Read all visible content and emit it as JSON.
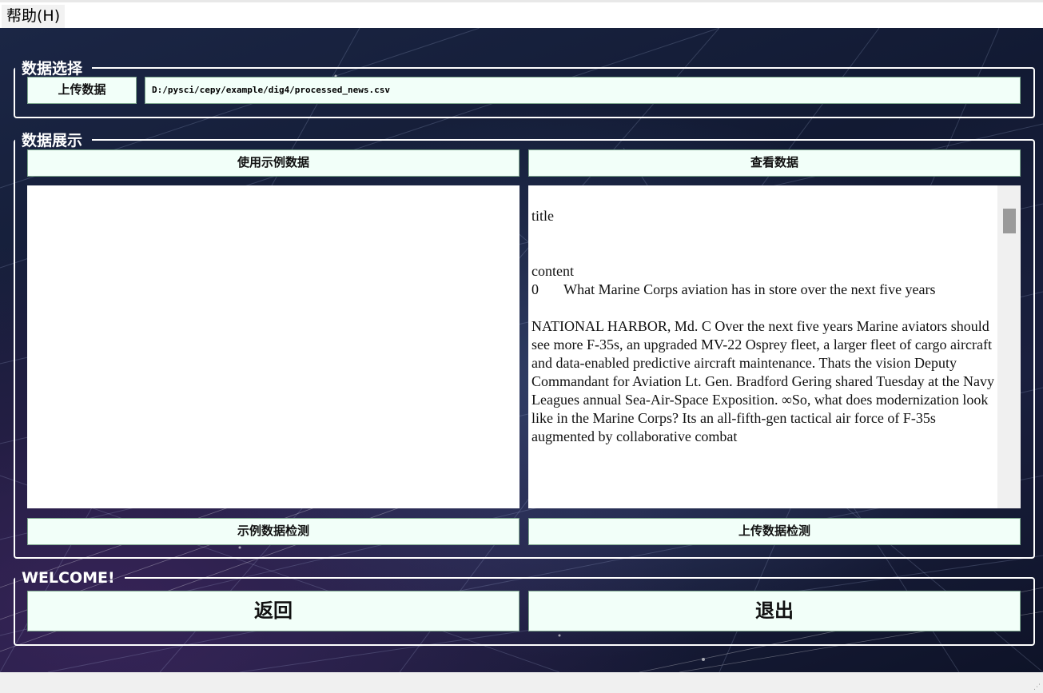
{
  "menu": {
    "help_label": "帮助(H)"
  },
  "data_select": {
    "legend": "数据选择",
    "upload_label": "上传数据",
    "file_path": "D:/pysci/cepy/example/dig4/processed_news.csv"
  },
  "data_show": {
    "legend": "数据展示",
    "sample_label": "使用示例数据",
    "view_label": "查看数据",
    "sample_detect_label": "示例数据检测",
    "upload_detect_label": "上传数据检测",
    "right_text": "title\n\n\ncontent\n0       What Marine Corps aviation has in store over the next five years\n\nNATIONAL HARBOR, Md. C Over the next five years Marine aviators should see more F-35s, an upgraded MV-22 Osprey fleet, a larger fleet of cargo aircraft and data-enabled predictive aircraft maintenance. Thats the vision Deputy Commandant for Aviation Lt. Gen. Bradford Gering shared Tuesday at the Navy Leagues annual Sea-Air-Space Exposition. ∞So, what does modernization look like in the Marine Corps? Its an all-fifth-gen tactical air force of F-35s augmented by collaborative combat"
  },
  "welcome": {
    "legend": "WELCOME!",
    "back_label": "返回",
    "exit_label": "退出"
  }
}
